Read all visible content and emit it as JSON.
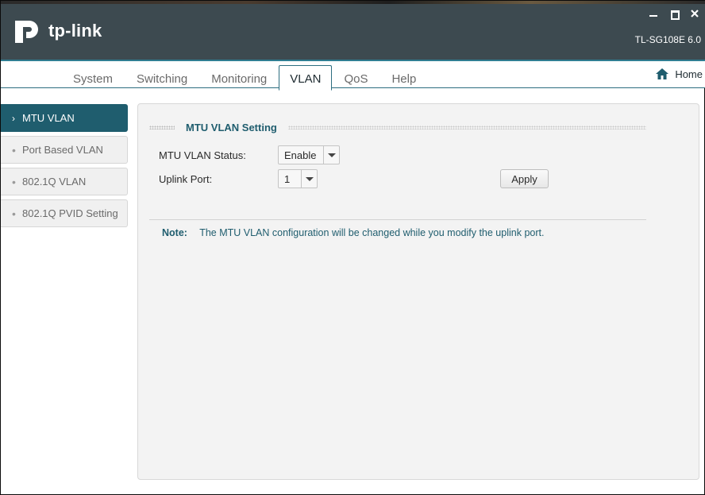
{
  "app": {
    "brand": "tp-link",
    "model": "TL-SG108E 6.0"
  },
  "menu": {
    "tabs": [
      {
        "label": "System"
      },
      {
        "label": "Switching"
      },
      {
        "label": "Monitoring"
      },
      {
        "label": "VLAN",
        "active": true
      },
      {
        "label": "QoS"
      },
      {
        "label": "Help"
      }
    ],
    "home_label": "Home"
  },
  "sidenav": {
    "items": [
      {
        "label": "MTU VLAN",
        "active": true
      },
      {
        "label": "Port Based VLAN"
      },
      {
        "label": "802.1Q VLAN"
      },
      {
        "label": "802.1Q PVID Setting"
      }
    ]
  },
  "content": {
    "section_title": "MTU VLAN Setting",
    "status_label": "MTU VLAN Status:",
    "status_value": "Enable",
    "uplink_label": "Uplink Port:",
    "uplink_value": "1",
    "apply_label": "Apply",
    "note_label": "Note:",
    "note_text": "The MTU VLAN configuration will be changed while you modify the uplink port."
  },
  "colors": {
    "titlebar": "#3d4a50",
    "accent": "#1f5d6e",
    "panel": "#f3f3f3"
  }
}
